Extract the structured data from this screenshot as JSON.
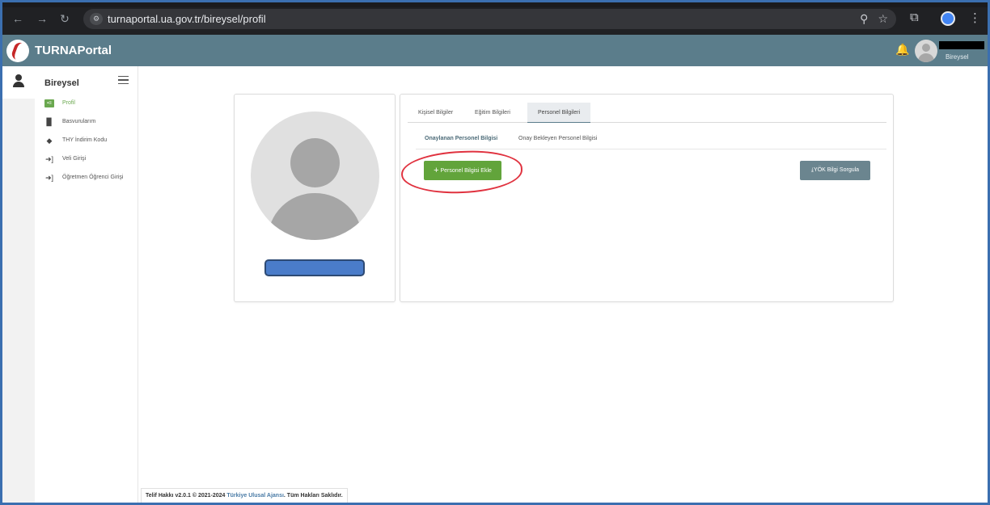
{
  "browser": {
    "url": "turnaportal.ua.gov.tr/bireysel/profil",
    "back_icon": "←",
    "forward_icon": "→",
    "reload_icon": "↻"
  },
  "header": {
    "brand": "TURNAPortal",
    "user_role": "Bireysel"
  },
  "sidebar": {
    "title": "Bireysel",
    "items": [
      {
        "label": "Profil",
        "icon": "id-card-icon",
        "active": true
      },
      {
        "label": "Basvurularım",
        "icon": "clipboard-icon",
        "active": false
      },
      {
        "label": "THY İndirim Kodu",
        "icon": "tag-icon",
        "active": false
      },
      {
        "label": "Veli Girişi",
        "icon": "sign-in-icon",
        "active": false
      },
      {
        "label": "Öğretmen Öğrenci Girişi",
        "icon": "sign-in-icon",
        "active": false
      }
    ]
  },
  "profile": {
    "tabs": [
      "Kişisel Bilgiler",
      "Eğitim Bilgileri",
      "Personel Bilgileri"
    ],
    "active_tab": "Personel Bilgileri",
    "subtabs": [
      "Onaylanan Personel Bilgisi",
      "Onay Bekleyen Personel Bilgisi"
    ],
    "add_button": "Personel Bilgisi Ekle",
    "yok_button": "YÖK Bilgi Sorgula"
  },
  "footer": {
    "prefix": "Telif Hakkı v2.0.1 © 2021-2024 ",
    "link": "Türkiye Ulusal Ajansı",
    "suffix": ". Tüm Hakları Saklıdır."
  },
  "colors": {
    "header": "#5b7d8b",
    "accent_green": "#62a43b",
    "annotation_red": "#e0323f"
  }
}
